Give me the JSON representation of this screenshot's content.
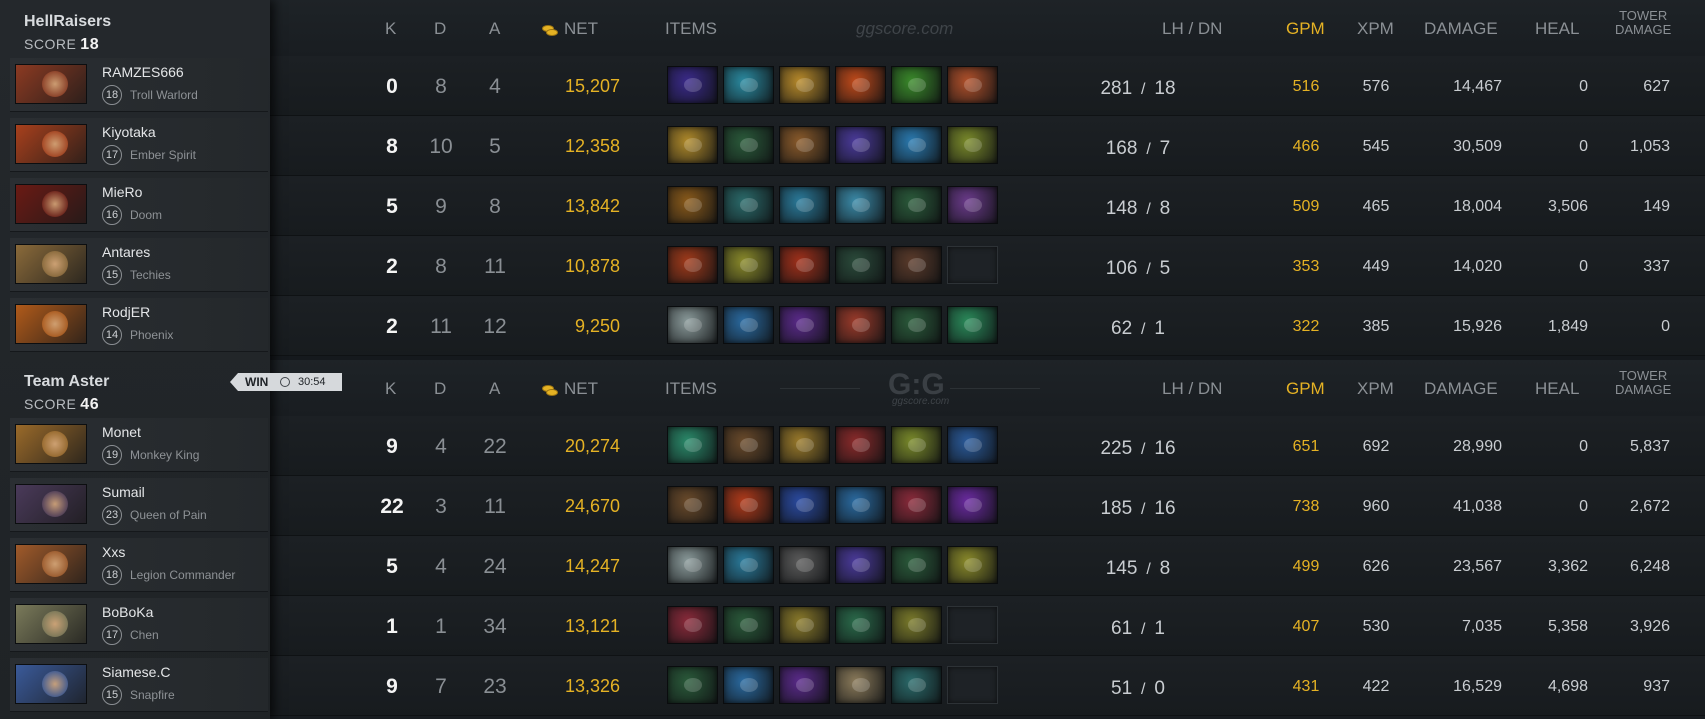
{
  "columns": {
    "k": "K",
    "d": "D",
    "a": "A",
    "net": "NET",
    "items": "ITEMS",
    "lh_dn": "LH  /  DN",
    "gpm": "GPM",
    "xpm": "XPM",
    "damage": "DAMAGE",
    "heal": "HEAL",
    "tower_line1": "TOWER",
    "tower_line2": "DAMAGE"
  },
  "watermark_top": "ggscore.com",
  "watermark_mid": "G:G",
  "watermark_mid_sub": "ggscore.com",
  "result": {
    "label": "WIN",
    "duration": "30:54"
  },
  "teams": [
    {
      "name": "HellRaisers",
      "score_label": "SCORE",
      "score": "18",
      "players": [
        {
          "name": "RAMZES666",
          "level": "18",
          "hero": "Troll Warlord",
          "k": "0",
          "d": "8",
          "a": "4",
          "net": "15,207",
          "lh": "281",
          "dn": "18",
          "gpm": "516",
          "xpm": "576",
          "damage": "14,467",
          "heal": "0",
          "tower": "627",
          "hero_color": "#8c3a22",
          "items": [
            "#3a2a8a",
            "#2a8aa0",
            "#b88a2a",
            "#c04a1a",
            "#3a8a2a",
            "#b0502a"
          ]
        },
        {
          "name": "Kiyotaka",
          "level": "17",
          "hero": "Ember Spirit",
          "k": "8",
          "d": "10",
          "a": "5",
          "net": "12,358",
          "lh": "168",
          "dn": "7",
          "gpm": "466",
          "xpm": "545",
          "damage": "30,509",
          "heal": "0",
          "tower": "1,053",
          "hero_color": "#a8401c",
          "items": [
            "#b08a2a",
            "#2a5a3a",
            "#8a5a2a",
            "#4a3a9a",
            "#2a7ab0",
            "#7a8a2a"
          ]
        },
        {
          "name": "MieRo",
          "level": "16",
          "hero": "Doom",
          "k": "5",
          "d": "9",
          "a": "8",
          "net": "13,842",
          "lh": "148",
          "dn": "8",
          "gpm": "509",
          "xpm": "465",
          "damage": "18,004",
          "heal": "3,506",
          "tower": "149",
          "hero_color": "#6a1a14",
          "items": [
            "#8a5a1a",
            "#2a6a6a",
            "#2a7a9a",
            "#3a8aa8",
            "#2a5a3a",
            "#6a3a8a"
          ]
        },
        {
          "name": "Antares",
          "level": "15",
          "hero": "Techies",
          "k": "2",
          "d": "8",
          "a": "11",
          "net": "10,878",
          "lh": "106",
          "dn": "5",
          "gpm": "353",
          "xpm": "449",
          "damage": "14,020",
          "heal": "0",
          "tower": "337",
          "hero_color": "#8a6a3a",
          "items": [
            "#a03a1a",
            "#8a8a2a",
            "#a0301a",
            "#2a4a3a",
            "#5a3a2a",
            ""
          ]
        },
        {
          "name": "RodjER",
          "level": "14",
          "hero": "Phoenix",
          "k": "2",
          "d": "11",
          "a": "12",
          "net": "9,250",
          "lh": "62",
          "dn": "1",
          "gpm": "322",
          "xpm": "385",
          "damage": "15,926",
          "heal": "1,849",
          "tower": "0",
          "hero_color": "#b05a1a",
          "items": [
            "#8a9a9a",
            "#2a6aa0",
            "#5a2a8a",
            "#9a3a2a",
            "#2a5a3a",
            "#2a8a5a"
          ]
        }
      ]
    },
    {
      "name": "Team Aster",
      "score_label": "SCORE",
      "score": "46",
      "players": [
        {
          "name": "Monet",
          "level": "19",
          "hero": "Monkey King",
          "k": "9",
          "d": "4",
          "a": "22",
          "net": "20,274",
          "lh": "225",
          "dn": "16",
          "gpm": "651",
          "xpm": "692",
          "damage": "28,990",
          "heal": "0",
          "tower": "5,837",
          "hero_color": "#9a6a2a",
          "items": [
            "#2a8a6a",
            "#6a4a2a",
            "#9a7a2a",
            "#8a2a2a",
            "#7a8a2a",
            "#2a5a9a"
          ]
        },
        {
          "name": "Sumail",
          "level": "23",
          "hero": "Queen of Pain",
          "k": "22",
          "d": "3",
          "a": "11",
          "net": "24,670",
          "lh": "185",
          "dn": "16",
          "gpm": "738",
          "xpm": "960",
          "damage": "41,038",
          "heal": "0",
          "tower": "2,672",
          "hero_color": "#4a3a5a",
          "items": [
            "#6a4a2a",
            "#b03a1a",
            "#2a4aa0",
            "#2a6aa0",
            "#8a2a3a",
            "#6a2aa0"
          ]
        },
        {
          "name": "Xxs",
          "level": "18",
          "hero": "Legion Commander",
          "k": "5",
          "d": "4",
          "a": "24",
          "net": "14,247",
          "lh": "145",
          "dn": "8",
          "gpm": "499",
          "xpm": "626",
          "damage": "23,567",
          "heal": "3,362",
          "tower": "6,248",
          "hero_color": "#a05a2a",
          "items": [
            "#8a9a9a",
            "#2a7a9a",
            "#5a5a5a",
            "#4a3a9a",
            "#2a5a3a",
            "#8a8a2a"
          ]
        },
        {
          "name": "BoBoKa",
          "level": "17",
          "hero": "Chen",
          "k": "1",
          "d": "1",
          "a": "34",
          "net": "13,121",
          "lh": "61",
          "dn": "1",
          "gpm": "407",
          "xpm": "530",
          "damage": "7,035",
          "heal": "5,358",
          "tower": "3,926",
          "hero_color": "#7a7a5a",
          "items": [
            "#8a2a3a",
            "#2a5a3a",
            "#8a7a2a",
            "#2a6a4a",
            "#7a7a2a",
            ""
          ]
        },
        {
          "name": "Siamese.C",
          "level": "15",
          "hero": "Snapfire",
          "k": "9",
          "d": "7",
          "a": "23",
          "net": "13,326",
          "lh": "51",
          "dn": "0",
          "gpm": "431",
          "xpm": "422",
          "damage": "16,529",
          "heal": "4,698",
          "tower": "937",
          "hero_color": "#3a5a9a",
          "items": [
            "#2a5a3a",
            "#2a6aa0",
            "#5a2a8a",
            "#8a7a5a",
            "#2a6a6a",
            ""
          ]
        }
      ]
    }
  ]
}
